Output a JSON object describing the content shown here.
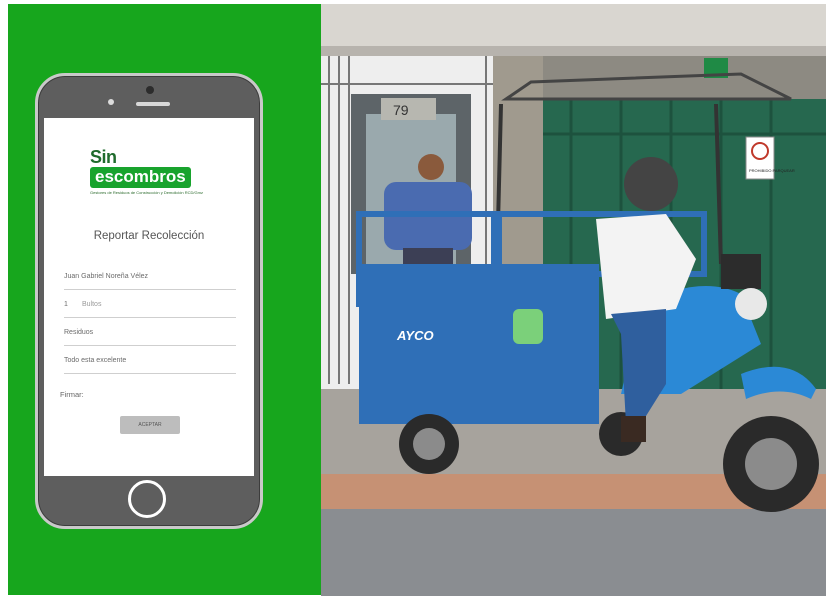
{
  "app": {
    "brand_line1": "Sin",
    "brand_line2": "escombros",
    "brand_tagline": "Gestores de Residuos de Construcción y Demolición",
    "brand_sub": "RCD/Gmz"
  },
  "form": {
    "title": "Reportar Recolección",
    "name_value": "Juan Gabriel Noreña Vélez",
    "quantity_value": "1",
    "quantity_unit": "Bultos",
    "waste_value": "Residuos",
    "comment_value": "Todo esta excelente",
    "signature_label": "Firmar:",
    "accept_label": "ACEPTAR"
  },
  "photo": {
    "vehicle_brand": "AYCO",
    "house_number": "79",
    "parking_sign": "PROHIBIDO PARQUEAR"
  },
  "colors": {
    "panel_green": "#17a61d",
    "brand_green": "#18a32d",
    "truck_blue": "#2f6fb7"
  }
}
